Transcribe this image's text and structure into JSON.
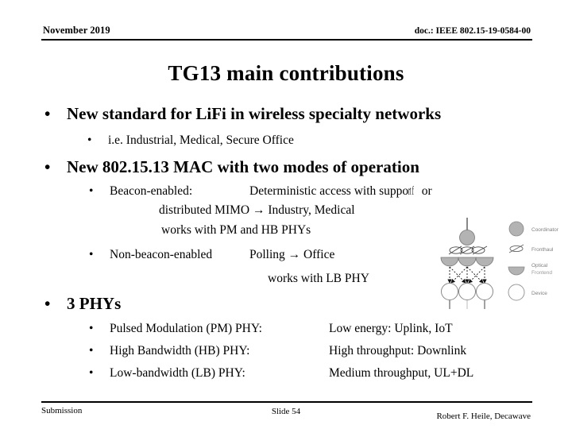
{
  "header": {
    "date": "November 2019",
    "doc_id": "doc.: IEEE 802.15-19-0584-00"
  },
  "title": "TG13 main contributions",
  "content": {
    "bullet1": {
      "marker": "•",
      "text": "New standard for LiFi in wireless specialty networks",
      "sub": [
        {
          "marker": "•",
          "text": "i.e. Industrial, Medical, Secure Office"
        }
      ]
    },
    "bullet2": {
      "marker": "•",
      "text": "New 802.15.13 MAC with two modes of operation",
      "sub": [
        {
          "marker": "•",
          "label": "Beacon-enabled:",
          "desc_visible": "Deterministic access with suppo",
          "desc_overlap": "rt f",
          "desc_tail": "or",
          "desc_full": "Deterministic access with support for"
        },
        {
          "marker": "",
          "text": "distributed MIMO → Industry, Medical"
        },
        {
          "marker": "",
          "text": "works with PM and HB PHYs"
        },
        {
          "marker": "•",
          "label": "Non-beacon-enabled",
          "text": "Polling → Office"
        },
        {
          "marker": "",
          "text": "works with LB PHY"
        }
      ]
    },
    "bullet3": {
      "marker": "•",
      "text": "3 PHYs",
      "rows": [
        {
          "marker": "•",
          "label": "Pulsed Modulation (PM) PHY:",
          "value": "Low energy: Uplink, IoT"
        },
        {
          "marker": "•",
          "label": "High Bandwidth (HB) PHY:",
          "value": "High throughput: Downlink"
        },
        {
          "marker": "•",
          "label": "Low-bandwidth (LB) PHY:",
          "value": "Medium throughput, UL+DL"
        }
      ]
    }
  },
  "diagram": {
    "legend": [
      {
        "shape": "filled-circle",
        "label": "Coordinator"
      },
      {
        "shape": "fronthaul-link",
        "label": "Fronthaul"
      },
      {
        "shape": "half-dome",
        "label_line1": "Optical",
        "label_line2": "Frontend"
      },
      {
        "shape": "open-circle",
        "label": "Device"
      }
    ],
    "node_counts": {
      "coordinator": 1,
      "optical_frontend": 3,
      "device": 3
    },
    "colors": {
      "fill_gray": "#b3b3b3",
      "stroke": "#808080",
      "text": "#808080"
    }
  },
  "footer": {
    "left": "Submission",
    "center": "Slide 54",
    "right": "Robert F. Heile, Decawave"
  }
}
